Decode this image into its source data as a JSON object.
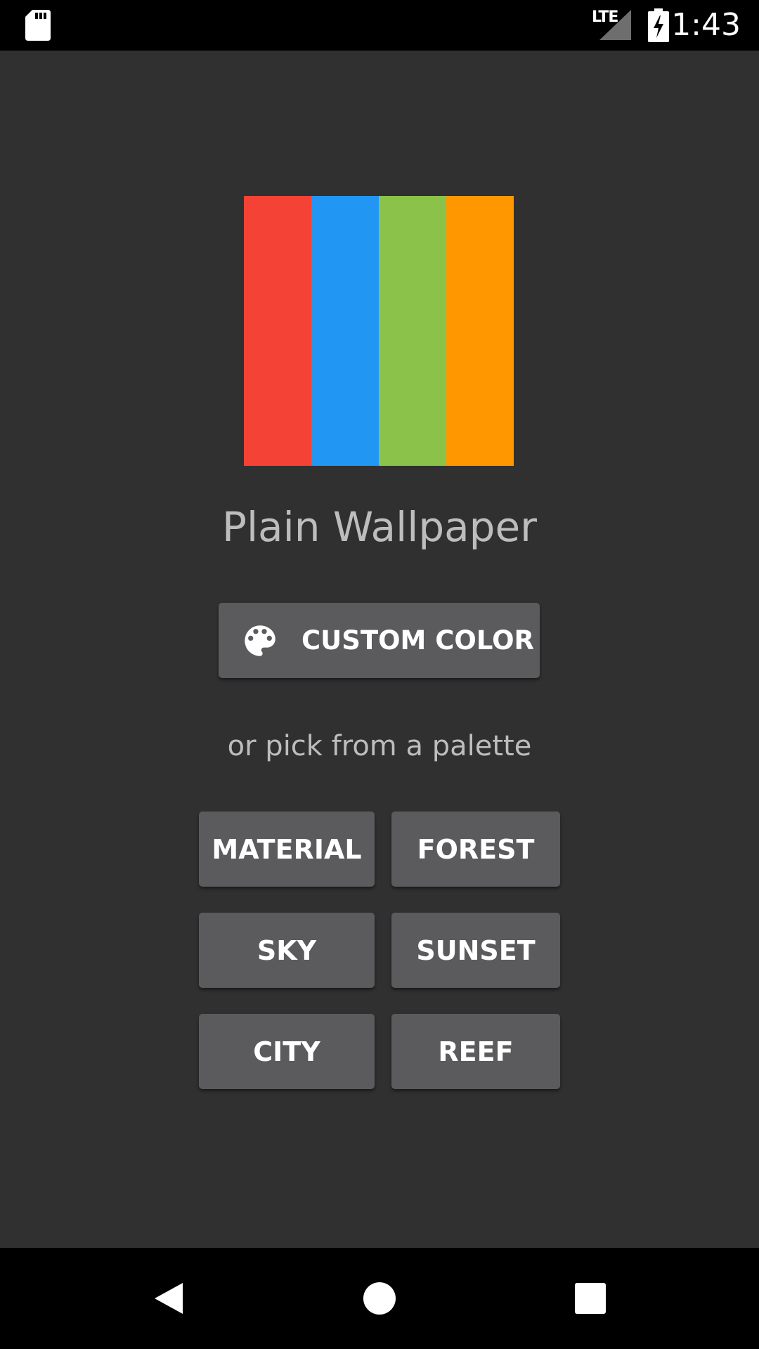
{
  "status_bar": {
    "network_label": "LTE",
    "time": "1:43",
    "icons": [
      "sd-card-icon",
      "signal-icon",
      "battery-charging-icon"
    ]
  },
  "logo": {
    "colors": [
      "#f44336",
      "#2196f3",
      "#8bc34a",
      "#ff9800"
    ]
  },
  "app": {
    "title": "Plain Wallpaper"
  },
  "custom_color_button": {
    "icon": "palette-icon",
    "label": "CUSTOM COLOR"
  },
  "palette_prompt": "or pick from a palette",
  "palettes": [
    {
      "label": "MATERIAL"
    },
    {
      "label": "FOREST"
    },
    {
      "label": "SKY"
    },
    {
      "label": "SUNSET"
    },
    {
      "label": "CITY"
    },
    {
      "label": "REEF"
    }
  ],
  "nav_bar": {
    "icons": [
      "back-icon",
      "home-icon",
      "recents-icon"
    ]
  },
  "colors": {
    "background": "#303030",
    "button": "#5b5b5d",
    "text_muted": "#bdbdbd",
    "bars": "#000000"
  }
}
